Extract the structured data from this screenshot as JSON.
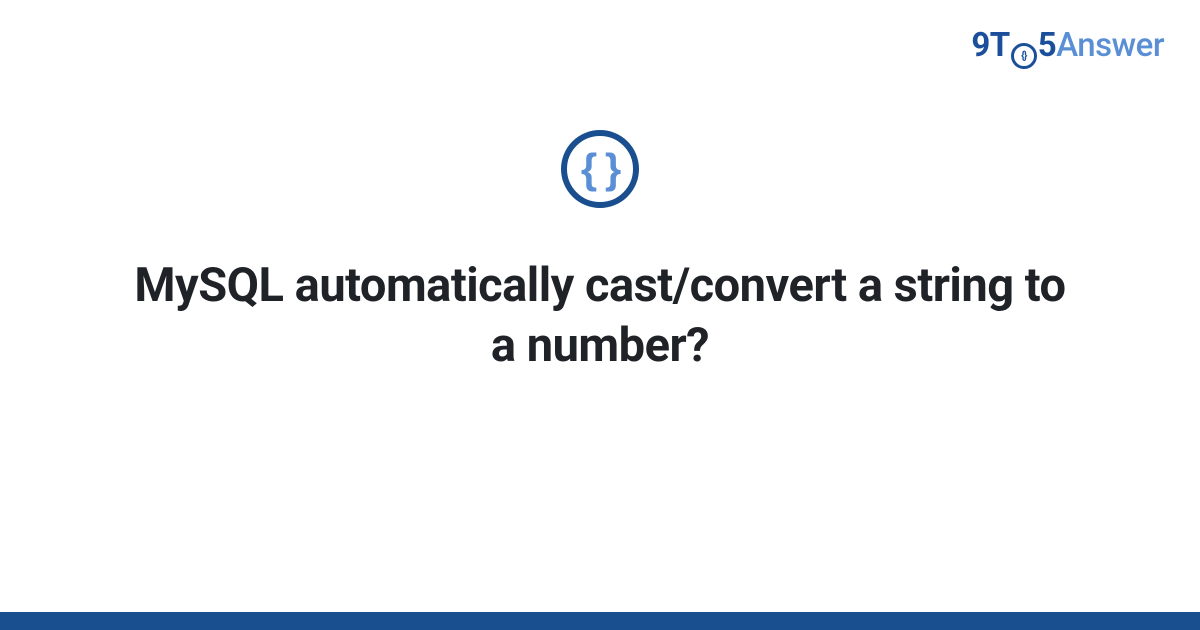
{
  "logo": {
    "part1": "9T",
    "part2": "5",
    "part3": "Answer"
  },
  "category_icon": {
    "name": "code-braces-icon",
    "glyph": "{ }"
  },
  "title": "MySQL automatically cast/convert a string to a number?",
  "colors": {
    "brand_dark": "#194e8f",
    "brand_light": "#5a8fd6",
    "text": "#1f2328"
  }
}
